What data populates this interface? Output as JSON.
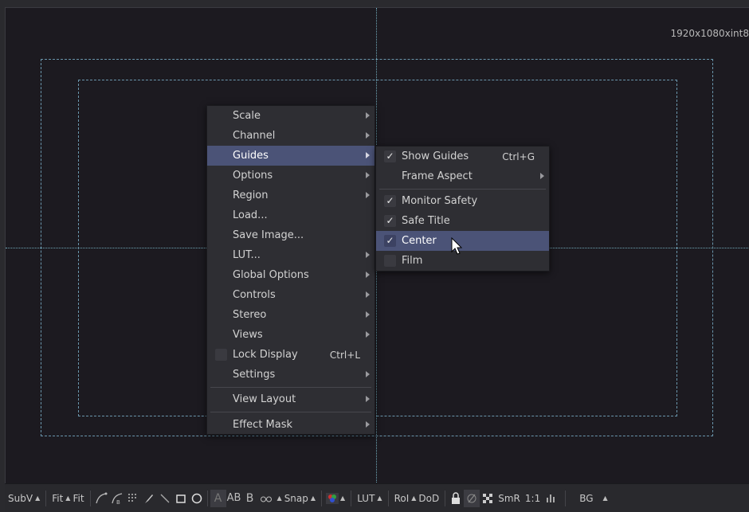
{
  "viewer": {
    "resolution_label": "1920x1080xint8",
    "guides_color": "#6a96ac"
  },
  "context_menu": {
    "items": [
      {
        "label": "Scale",
        "submenu": true
      },
      {
        "label": "Channel",
        "submenu": true
      },
      {
        "label": "Guides",
        "submenu": true,
        "highlighted": true
      },
      {
        "label": "Options",
        "submenu": true
      },
      {
        "label": "Region",
        "submenu": true
      },
      {
        "label": "Load..."
      },
      {
        "label": "Save Image..."
      },
      {
        "label": "LUT...",
        "submenu": true
      },
      {
        "label": "Global Options",
        "submenu": true
      },
      {
        "label": "Controls",
        "submenu": true
      },
      {
        "label": "Stereo",
        "submenu": true
      },
      {
        "label": "Views",
        "submenu": true
      },
      {
        "label": "Lock Display",
        "shortcut": "Ctrl+L",
        "checkbox": true,
        "checked": false
      },
      {
        "label": "Settings",
        "submenu": true
      },
      {
        "label": "View Layout",
        "submenu": true
      },
      {
        "label": "Effect Mask",
        "submenu": true
      }
    ]
  },
  "guides_submenu": {
    "items": [
      {
        "label": "Show Guides",
        "shortcut": "Ctrl+G",
        "checked": true
      },
      {
        "label": "Frame Aspect",
        "submenu": true
      },
      {
        "label": "Monitor Safety",
        "checked": true
      },
      {
        "label": "Safe Title",
        "checked": true
      },
      {
        "label": "Center",
        "checked": true,
        "highlighted": true
      },
      {
        "label": "Film",
        "checked": false
      }
    ]
  },
  "toolbar": {
    "subv": "SubV",
    "fit1": "Fit",
    "fit2": "Fit",
    "a": "A",
    "ab": "AB",
    "b": "B",
    "snap": "Snap",
    "lut": "LUT",
    "roi": "RoI",
    "dod": "DoD",
    "smr": "SmR",
    "ratio": "1:1",
    "bg": "BG",
    "accent": "#4b5377"
  }
}
